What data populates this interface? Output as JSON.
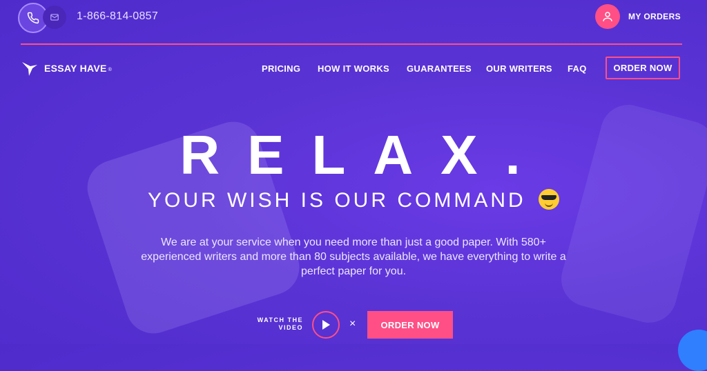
{
  "colors": {
    "accent": "#ff4f86",
    "background": "#5a33d4",
    "text": "#ffffff"
  },
  "topbar": {
    "phone_icon": "phone-icon",
    "mail_icon": "mail-icon",
    "phone_number": "1-866-814-0857",
    "orders_icon": "user-icon",
    "my_orders_label": "MY ORDERS"
  },
  "header": {
    "logo_icon": "hummingbird-logo-icon",
    "logo_text": "ESSAY HAVE",
    "logo_reg": "®",
    "nav": [
      {
        "label": "PRICING"
      },
      {
        "label": "HOW IT WORKS"
      },
      {
        "label": "GUARANTEES"
      },
      {
        "label": "OUR WRITERS"
      },
      {
        "label": "FAQ"
      }
    ],
    "order_now_label": "ORDER NOW"
  },
  "hero": {
    "headline": "RELAX.",
    "subheadline": "YOUR WISH IS OUR COMMAND",
    "emoji_icon": "sunglasses-emoji-icon",
    "description": "We are at your service when you need more than just a good paper. With 580+ experienced writers and more than 80 subjects available, we have everything to write a perfect paper for you.",
    "watch_label_line1": "WATCH THE",
    "watch_label_line2": "VIDEO",
    "play_icon": "play-icon",
    "separator": "×",
    "order_now_label": "ORDER NOW"
  }
}
